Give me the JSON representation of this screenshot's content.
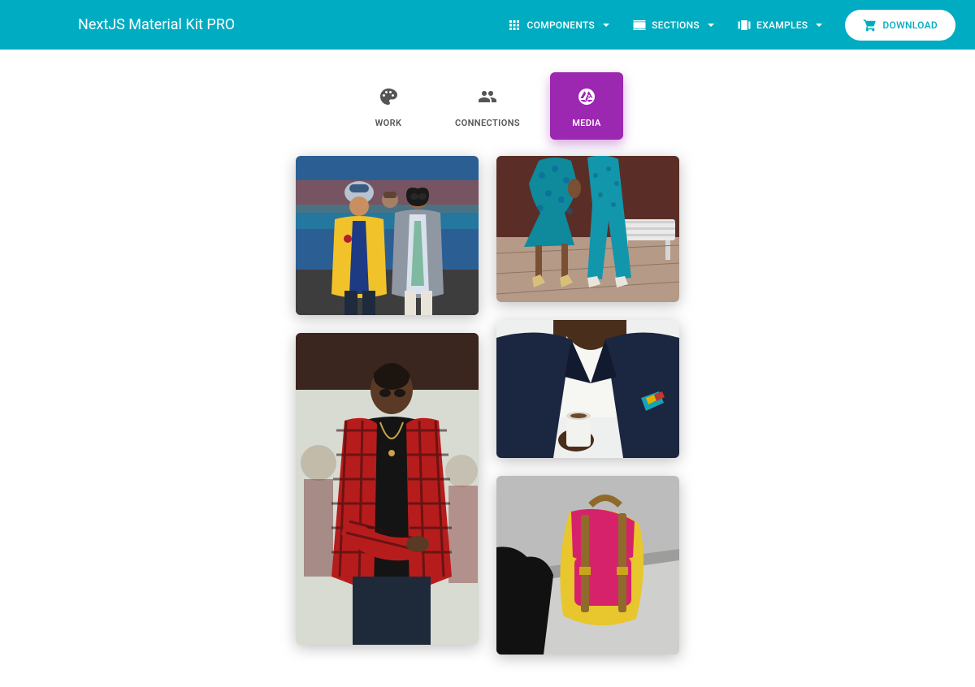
{
  "header": {
    "brand": "NextJS Material Kit PRO",
    "nav": {
      "components": "COMPONENTS",
      "sections": "SECTIONS",
      "examples": "EXAMPLES",
      "download": "DOWNLOAD"
    }
  },
  "tabs": {
    "work": "WORK",
    "connections": "CONNECTIONS",
    "media": "MEDIA",
    "active": "media"
  },
  "gallery": {
    "columns": [
      [
        "street-fashion-men",
        "man-red-shirt"
      ],
      [
        "women-walking-blue",
        "man-suit-coffee",
        "pink-yellow-backpack"
      ]
    ]
  },
  "colors": {
    "primary": "#00acc1",
    "accent": "#9c27b0"
  }
}
